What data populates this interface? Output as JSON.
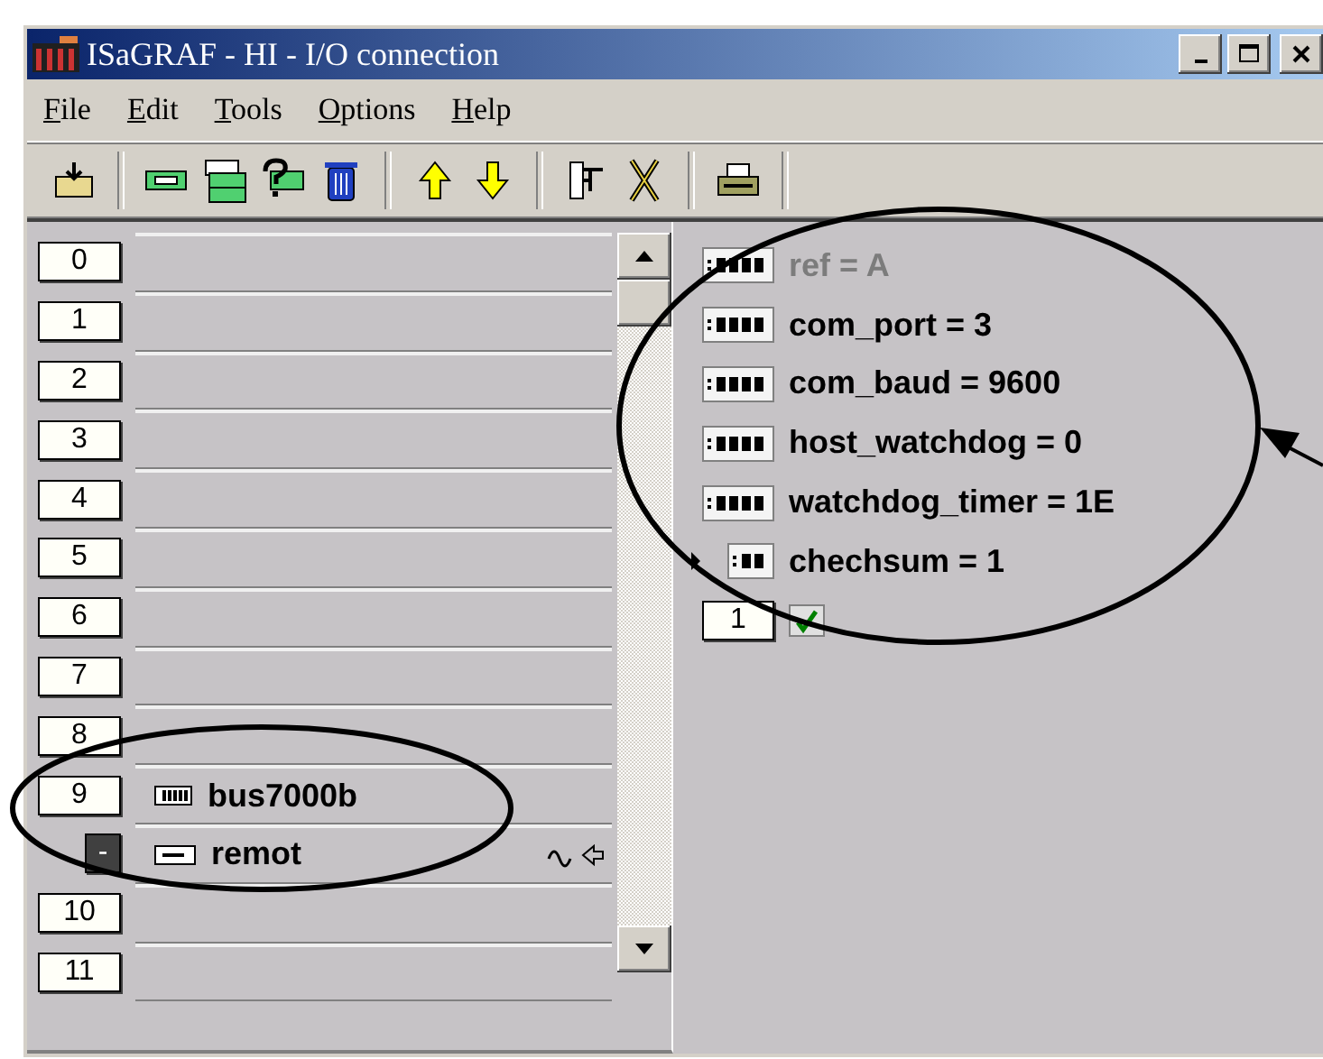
{
  "window": {
    "title": "ISaGRAF - HI - I/O connection"
  },
  "menu": [
    {
      "label": "File"
    },
    {
      "label": "Edit"
    },
    {
      "label": "Tools"
    },
    {
      "label": "Options"
    },
    {
      "label": "Help"
    }
  ],
  "slots": [
    {
      "number": "0"
    },
    {
      "number": "1"
    },
    {
      "number": "2"
    },
    {
      "number": "3"
    },
    {
      "number": "4"
    },
    {
      "number": "5"
    },
    {
      "number": "6"
    },
    {
      "number": "7"
    },
    {
      "number": "8"
    },
    {
      "number": "9",
      "board": "bus7000b",
      "equipment": {
        "toggle": "-",
        "name": "remot",
        "expanded": true
      }
    },
    {
      "number": "10"
    },
    {
      "number": "11"
    }
  ],
  "parameters": [
    {
      "kind": "wide",
      "text": "ref = A",
      "disabled": true,
      "current": false
    },
    {
      "kind": "wide",
      "text": "com_port = 3",
      "disabled": false,
      "current": false
    },
    {
      "kind": "wide",
      "text": "com_baud = 9600",
      "disabled": false,
      "current": false
    },
    {
      "kind": "wide",
      "text": "host_watchdog = 0",
      "disabled": false,
      "current": false
    },
    {
      "kind": "wide",
      "text": "watchdog_timer = 1E",
      "disabled": false,
      "current": false
    },
    {
      "kind": "narrow",
      "text": "chechsum = 1",
      "disabled": false,
      "current": true
    }
  ],
  "channel": {
    "index": "1",
    "checked": true
  }
}
